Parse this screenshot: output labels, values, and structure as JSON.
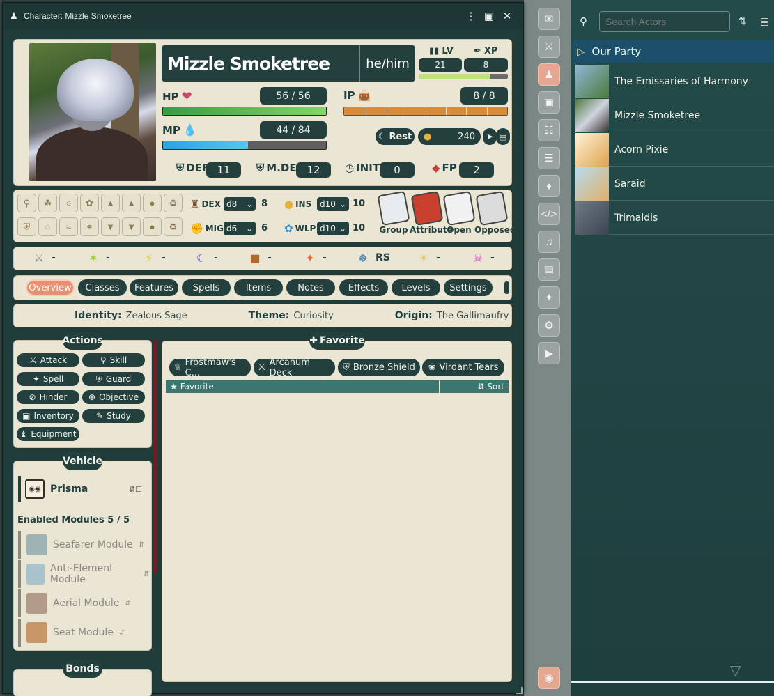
{
  "window": {
    "title": "Character: Mizzle Smoketree"
  },
  "character": {
    "name": "Mizzle Smoketree",
    "pronouns": "he/him",
    "lv_label": "LV",
    "xp_label": "XP",
    "level": "21",
    "xp": "8",
    "xp_fraction": 0.8,
    "hp_label": "HP",
    "hp": "56 / 56",
    "hp_fraction": 1.0,
    "mp_label": "MP",
    "mp": "44 / 84",
    "mp_fraction": 0.52,
    "ip_label": "IP",
    "ip": "8 / 8",
    "ip_segments": 8,
    "rest_label": "Rest",
    "zenit": "240",
    "def_label": "DEF",
    "def": "11",
    "mdef_label": "M.DEF",
    "mdef": "12",
    "init_label": "INIT",
    "init": "0",
    "fp_label": "FP",
    "fp": "2"
  },
  "attributes": {
    "dex": {
      "label": "DEX",
      "die": "d8",
      "value": "8"
    },
    "ins": {
      "label": "INS",
      "die": "d10",
      "value": "10"
    },
    "mig": {
      "label": "MIG",
      "die": "d6",
      "value": "6"
    },
    "wlp": {
      "label": "WLP",
      "die": "d10",
      "value": "10"
    }
  },
  "rolls": [
    "Group",
    "Attribute",
    "Open",
    "Opposed"
  ],
  "affinities": [
    "-",
    "-",
    "-",
    "-",
    "-",
    "-",
    "RS",
    "-",
    "-"
  ],
  "tabs": [
    "Overview",
    "Classes",
    "Features",
    "Spells",
    "Items",
    "Notes",
    "Effects",
    "Levels",
    "Settings"
  ],
  "identity": {
    "identity_label": "Identity:",
    "identity": "Zealous Sage",
    "theme_label": "Theme:",
    "theme": "Curiosity",
    "origin_label": "Origin:",
    "origin": "The Gallimaufry"
  },
  "actions": {
    "header": "Actions",
    "buttons": [
      "Attack",
      "Skill",
      "Spell",
      "Guard",
      "Hinder",
      "Objective",
      "Inventory",
      "Study",
      "Equipment"
    ]
  },
  "vehicle": {
    "header": "Vehicle",
    "name": "Prisma",
    "modules_label": "Enabled Modules 5 / 5",
    "modules": [
      "Seafarer Module",
      "Anti-Element Module",
      "Aerial Module",
      "Seat Module"
    ]
  },
  "bonds": {
    "header": "Bonds"
  },
  "favorites": {
    "add_label": "Favorite",
    "items": [
      "Frostmaw's C...",
      "Arcanum Deck",
      "Bronze Shield",
      "Virdant Tears"
    ],
    "col_favorite": "Favorite",
    "col_sort": "Sort"
  },
  "sidebar": {
    "search_placeholder": "Search Actors",
    "folder": "Our Party",
    "actors": [
      "The Emissaries of Harmony",
      "Mizzle Smoketree",
      "Acorn Pixie",
      "Saraid",
      "Trimaldis"
    ]
  }
}
